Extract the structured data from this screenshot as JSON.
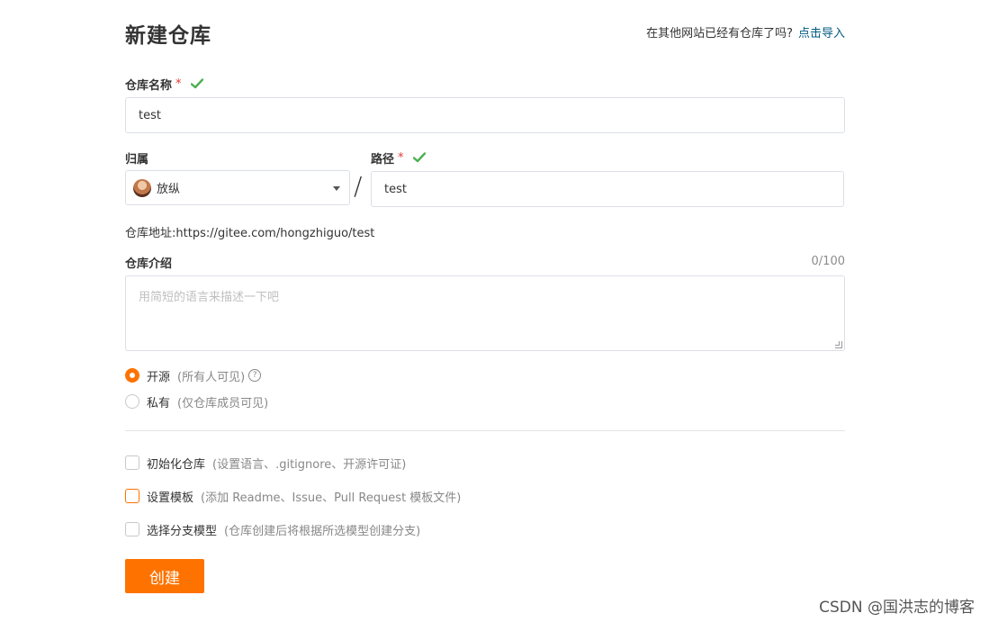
{
  "header": {
    "title": "新建仓库",
    "import_prompt": "在其他网站已经有仓库了吗?",
    "import_link": "点击导入"
  },
  "form": {
    "name_label": "仓库名称",
    "name_value": "test",
    "owner_label": "归属",
    "owner_value": "放纵",
    "separator": "/",
    "path_label": "路径",
    "path_value": "test",
    "required_mark": "*",
    "repo_url_label": "仓库地址:",
    "repo_url": "https://gitee.com/hongzhiguo/test",
    "desc_label": "仓库介绍",
    "desc_counter": "0/100",
    "desc_placeholder": "用简短的语言来描述一下吧"
  },
  "visibility": {
    "public_label": "开源",
    "public_hint": "(所有人可见)",
    "private_label": "私有",
    "private_hint": "(仅仓库成员可见)",
    "selected": "public"
  },
  "options": {
    "init_label": "初始化仓库",
    "init_hint": "(设置语言、.gitignore、开源许可证)",
    "template_label": "设置模板",
    "template_hint": "(添加 Readme、Issue、Pull Request 模板文件)",
    "branch_label": "选择分支模型",
    "branch_hint": "(仓库创建后将根据所选模型创建分支)"
  },
  "actions": {
    "create_label": "创建"
  },
  "colors": {
    "accent": "#fe7300",
    "link": "#005980",
    "success": "#4caf50",
    "required": "#e53935"
  },
  "watermark": "CSDN @国洪志的博客"
}
